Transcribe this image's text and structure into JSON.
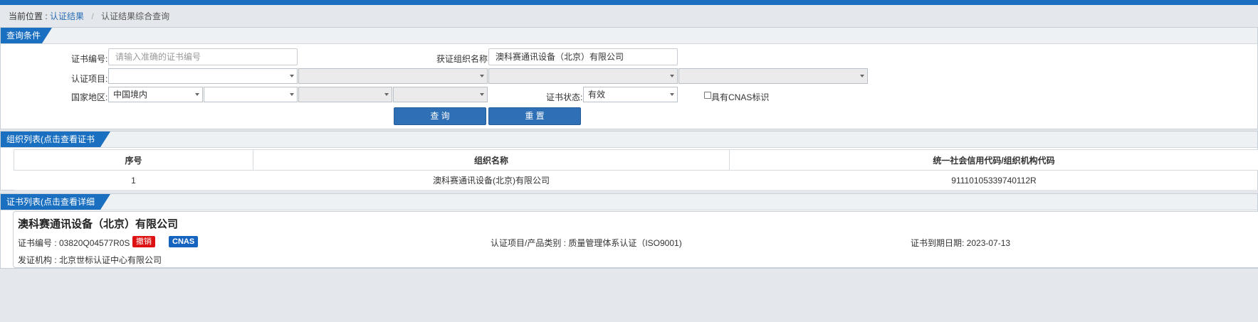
{
  "breadcrumb": {
    "label": "当前位置 :",
    "link": "认证结果",
    "separator": "/",
    "current": "认证结果综合查询"
  },
  "query": {
    "title": "查询条件",
    "cert_no_label": "证书编号:",
    "cert_no_placeholder": "请输入准确的证书编号",
    "org_name_label": "获证组织名称:",
    "org_name_value": "澳科赛通讯设备（北京）有限公司",
    "project_label": "认证项目:",
    "country_label": "国家地区:",
    "country_value": "中国境内",
    "status_label": "证书状态:",
    "status_value": "有效",
    "cnas_label": "具有CNAS标识",
    "search_button": "查 询",
    "reset_button": "重 置"
  },
  "org_list": {
    "title": "组织列表(点击查看证书信息)",
    "headers": [
      "序号",
      "组织名称",
      "统一社会信用代码/组织机构代码"
    ],
    "rows": [
      {
        "no": "1",
        "name": "澳科赛通讯设备(北京)有限公司",
        "code": "91110105339740112R"
      }
    ]
  },
  "cert_list": {
    "title": "证书列表(点击查看详细信息)",
    "items": [
      {
        "org": "澳科赛通讯设备（北京）有限公司",
        "cert_no": "证书编号 : 03820Q04577R0S",
        "status_badge": "撤销",
        "cnas_badge": "CNAS",
        "project": "认证项目/产品类别 : 质量管理体系认证（ISO9001)",
        "expiry": "证书到期日期: 2023-07-13",
        "issuer": "发证机构 : 北京世标认证中心有限公司"
      }
    ]
  },
  "colors": {
    "primary": "#1a6fc0",
    "button": "#2e6fb5",
    "revoked": "#dd1111",
    "cnas": "#1565c0"
  }
}
